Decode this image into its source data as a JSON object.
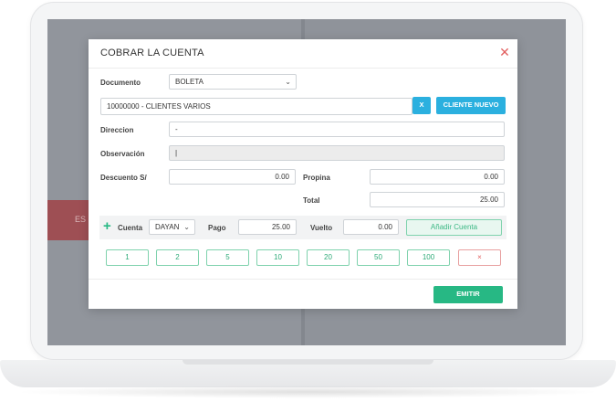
{
  "modal": {
    "title": "COBRAR LA CUENTA",
    "close_glyph": "✕"
  },
  "form": {
    "documento_label": "Documento",
    "documento_value": "BOLETA",
    "cliente_value": "10000000 - CLIENTES VARIOS",
    "btn_x": "X",
    "btn_cliente_nuevo": "CLIENTE NUEVO",
    "direccion_label": "Direccion",
    "direccion_value": "-",
    "observacion_label": "Observación",
    "observacion_value": "|",
    "descuento_label": "Descuento S/",
    "descuento_value": "0.00",
    "propina_label": "Propina",
    "propina_value": "0.00",
    "total_label": "Total",
    "total_value": "25.00"
  },
  "payment": {
    "plus_glyph": "+",
    "cuenta_label": "Cuenta",
    "cuenta_select": "DAYAN",
    "pago_label": "Pago",
    "pago_value": "25.00",
    "vuelto_label": "Vuelto",
    "vuelto_value": "0.00",
    "add_button": "Añadir Cuenta"
  },
  "quick_amounts": [
    "1",
    "2",
    "5",
    "10",
    "20",
    "50",
    "100",
    "×"
  ],
  "footer": {
    "emitir_button": "EMITIR"
  },
  "background": {
    "red_tab_text": "ES"
  },
  "colors": {
    "accent_blue": "#2bb0df",
    "accent_green": "#27b884",
    "close_red": "#e26060"
  }
}
